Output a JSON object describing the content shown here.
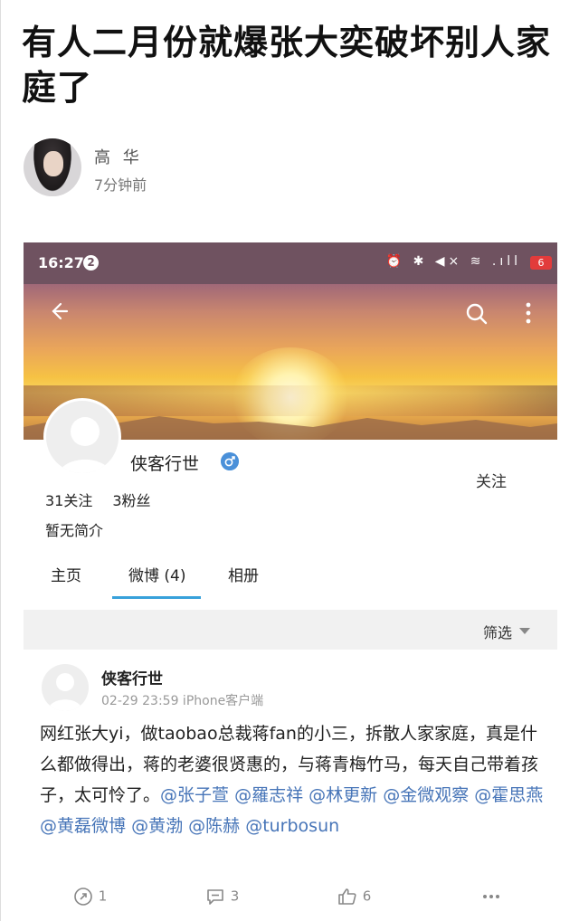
{
  "article": {
    "title": "有人二月份就爆张大奕破坏别人家庭了",
    "author": "高 华",
    "time": "7分钟前"
  },
  "status_bar": {
    "time": "16:27",
    "badge": "2",
    "battery": "6",
    "icons": "⏰ ✱ ◀× ≋ .ıll"
  },
  "profile": {
    "name": "侠客行世",
    "follow_label": "关注",
    "following": "31关注",
    "followers": "3粉丝",
    "bio": "暂无简介"
  },
  "tabs": [
    {
      "label": "主页"
    },
    {
      "label": "微博 (4)"
    },
    {
      "label": "相册"
    }
  ],
  "active_tab": "微博 (4)",
  "filter": {
    "label": "筛选"
  },
  "post": {
    "author": "侠客行世",
    "meta": "02-29 23:59  iPhone客户端",
    "text_plain": "网红张大yi，做taobao总裁蒋fan的小三，拆散人家家庭，真是什么都做得出，蒋的老婆很贤惠的，与蒋青梅竹马，每天自己带着孩子，太可怜了。",
    "mentions": [
      "@张子萱",
      "@羅志祥",
      "@林更新",
      "@金微观察",
      "@霍思燕",
      "@黄磊微博",
      "@黄渤",
      "@陈赫",
      "@turbosun"
    ],
    "repost_count": "1",
    "comment_count": "3",
    "like_count": "6"
  },
  "colors": {
    "accent": "#38a1db",
    "mention": "#4775b8",
    "status_bar": "#6f5260"
  }
}
